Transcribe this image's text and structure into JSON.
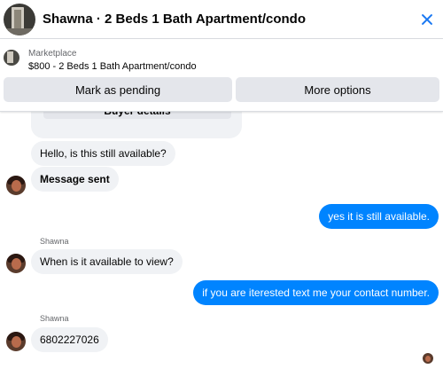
{
  "header": {
    "title": "Shawna · 2 Beds 1 Bath Apartment/condo"
  },
  "listing": {
    "marketplace_label": "Marketplace",
    "price_title": "$800 - 2 Beds 1 Bath Apartment/condo",
    "mark_pending_label": "Mark as pending",
    "more_options_label": "More options"
  },
  "chat": {
    "buyer_details_label": "Buyer details",
    "messages": [
      {
        "direction": "incoming",
        "text": "Hello, is this still available?"
      },
      {
        "direction": "incoming",
        "text": "Message sent"
      },
      {
        "direction": "outgoing",
        "text": "yes it is still available."
      },
      {
        "direction": "incoming",
        "sender": "Shawna",
        "text": "When is it available to view?"
      },
      {
        "direction": "outgoing",
        "text": "if you are iterested text me your contact number."
      },
      {
        "direction": "incoming",
        "sender": "Shawna",
        "text": "6802227026"
      }
    ]
  },
  "colors": {
    "accent": "#1877f2",
    "outgoing_bubble": "#0084ff",
    "incoming_bubble": "#f0f2f5",
    "button_bg": "#e4e6eb"
  },
  "icons": {
    "close": "close-icon"
  }
}
